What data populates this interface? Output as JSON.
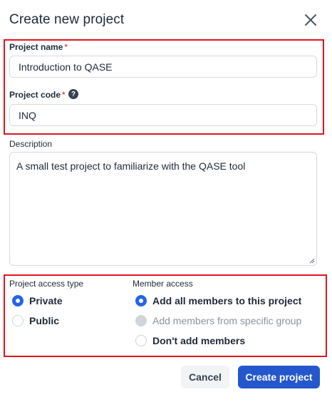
{
  "dialog": {
    "title": "Create new project",
    "close_icon": "close-icon"
  },
  "form": {
    "project_name": {
      "label": "Project name",
      "required_mark": "*",
      "value": "Introduction to QASE"
    },
    "project_code": {
      "label": "Project code",
      "required_mark": "*",
      "help_icon": "question-circle-icon",
      "help_glyph": "?",
      "value": "INQ"
    },
    "description": {
      "label": "Description",
      "value": "A small test project to familiarize with the QASE tool"
    }
  },
  "access": {
    "label": "Project access type",
    "options": [
      {
        "label": "Private",
        "checked": true
      },
      {
        "label": "Public",
        "checked": false
      }
    ]
  },
  "members": {
    "label": "Member access",
    "options": [
      {
        "label": "Add all members to this project",
        "checked": true,
        "disabled": false
      },
      {
        "label": "Add members from specific group",
        "checked": false,
        "disabled": true
      },
      {
        "label": "Don't add members",
        "checked": false,
        "disabled": false
      }
    ]
  },
  "footer": {
    "cancel_label": "Cancel",
    "create_label": "Create project"
  },
  "colors": {
    "highlight": "#e0141e",
    "primary": "#2457cc",
    "required": "#e0141e"
  }
}
